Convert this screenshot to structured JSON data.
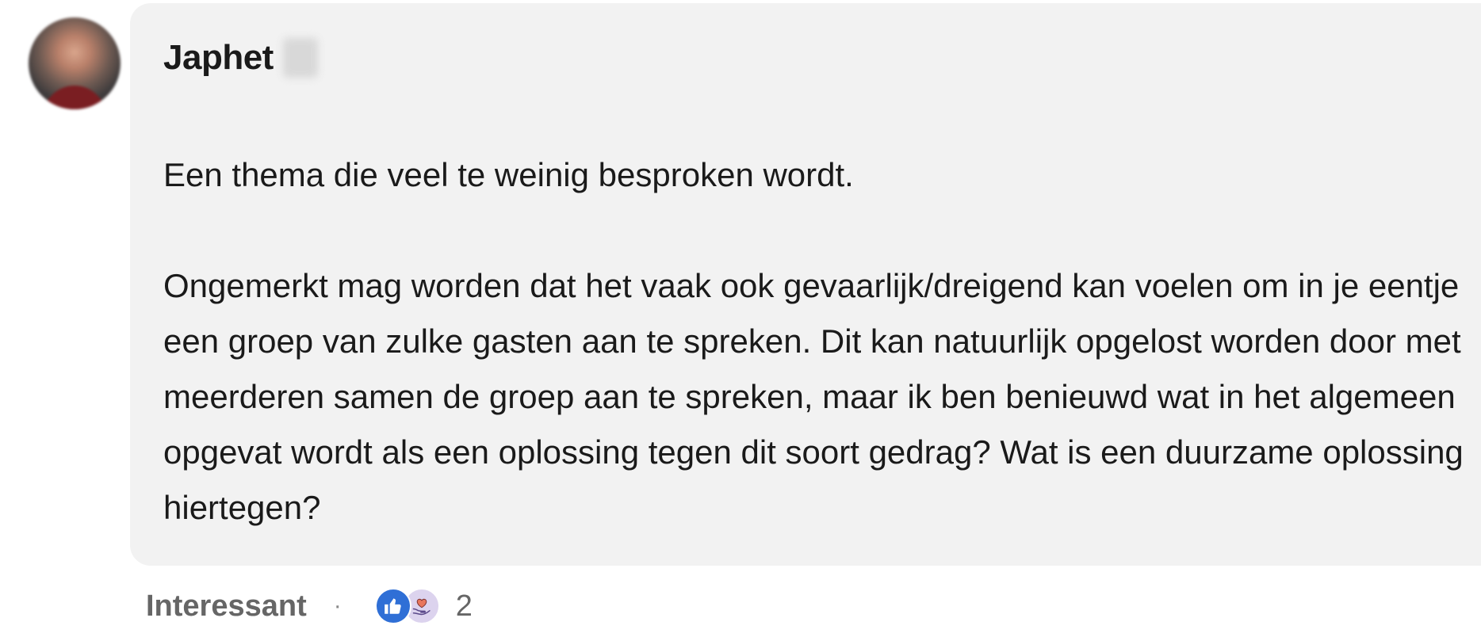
{
  "author": {
    "name": "Japhet"
  },
  "comment": {
    "paragraphs": [
      "Een thema die veel te weinig besproken wordt.",
      "Ongemerkt mag worden dat het vaak ook gevaarlijk/dreigend kan voelen om in je eentje een groep van zulke gasten aan te spreken. Dit kan natuurlijk opgelost worden door met meerderen samen de groep aan te spreken, maar ik ben benieuwd wat in het algemeen opgevat wordt als een oplossing tegen dit soort gedrag? Wat is een duurzame oplossing hiertegen?"
    ]
  },
  "footer": {
    "reaction_label": "Interessant",
    "separator": "·",
    "reaction_count": "2",
    "reaction_icons": [
      "like-icon",
      "support-icon"
    ]
  },
  "colors": {
    "bubble": "#f2f2f2",
    "like_blue": "#2f6fd6",
    "support_purple": "#dcd3ee",
    "muted_text": "#666666"
  }
}
